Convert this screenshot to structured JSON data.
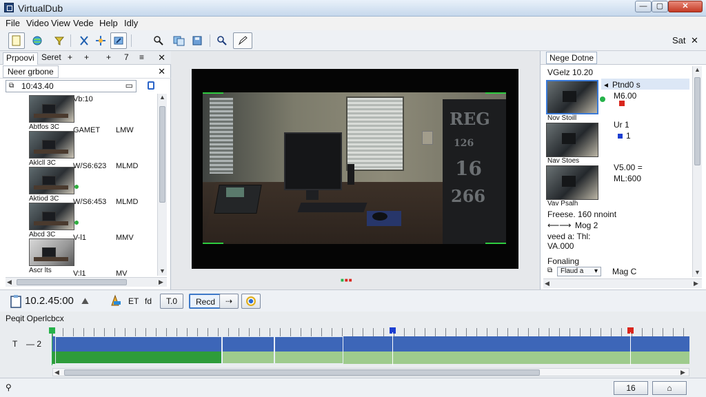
{
  "window": {
    "title": "VirtualDub",
    "min_label": "—",
    "max_label": "▢",
    "close_label": "✕"
  },
  "menu": [
    "File",
    "Video",
    "View",
    "Vede",
    "Help",
    "Idly"
  ],
  "toolbar": {
    "right_label": "Sat",
    "close_label": "✕"
  },
  "left_panel": {
    "tabs": [
      "Prpoovi",
      "Seret",
      "+",
      "+",
      "7",
      "≡"
    ],
    "close": "✕",
    "subtab": "Neer grbone",
    "subclose": "✕",
    "time_field": "10:43.40",
    "first_time": "Vb:10",
    "clips": [
      {
        "label": "Abtfos 3C",
        "name": "GAMET",
        "dim": "LMW"
      },
      {
        "label": "Aklcll 3C",
        "name": "W/S6:623",
        "dim": "MLMD"
      },
      {
        "label": "Aktiod 3C",
        "name": "W/S6:453",
        "dim": "MLMD"
      },
      {
        "label": "Abcd 3C",
        "name": "V-l1",
        "dim": "MMV"
      },
      {
        "label": "Ascr lts",
        "name": "V:l1",
        "dim": "MV"
      }
    ]
  },
  "right_panel": {
    "tab": "Nege Dotne",
    "title": "VGelz 10.20",
    "items": [
      {
        "caption": "Nov Stoill",
        "text1": "Ptnd0 s",
        "text2": "M6.00"
      },
      {
        "caption": "Nav Stoes",
        "text1": "Ur 1",
        "text2": "1"
      },
      {
        "caption": "Vav Psalh",
        "text1": "V5.00 =",
        "text2": "ML:600"
      }
    ],
    "frame_text": "Freese. 160 nnoint",
    "arrows_text": "Mog 2",
    "speed_text": "veed a: Thl:",
    "value_text": "VA.000",
    "section": "Fonaling",
    "field_value": "Flaud a",
    "field_right": "Mag C"
  },
  "transport": {
    "time": "10.2.45:00",
    "labels": [
      "ET",
      "fd"
    ],
    "buttons": [
      "T.0",
      "Recd",
      "⇢"
    ]
  },
  "timeline": {
    "label": "Peqit Operlcbcx",
    "track_label_a": "T",
    "track_label_b": "— 2"
  },
  "status": {
    "btn_a": "16",
    "btn_b": "⌂"
  },
  "video": {
    "cabinet_text": [
      "REG",
      "126",
      "16",
      "266"
    ]
  },
  "colors": {
    "timeline_blue": "#3d66b8",
    "timeline_green": "#2e9c3a",
    "marker_red": "#d9261c",
    "marker_blue": "#1c3fd1",
    "marker_green": "#26b24a"
  }
}
